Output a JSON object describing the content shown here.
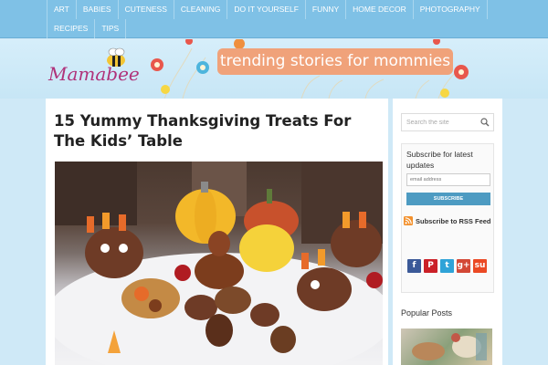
{
  "nav": {
    "row1": [
      "ART",
      "BABIES",
      "CUTENESS",
      "CLEANING",
      "DO IT YOURSELF",
      "FUNNY",
      "HOME DECOR",
      "PHOTOGRAPHY"
    ],
    "row2": [
      "RECIPES",
      "TIPS"
    ]
  },
  "header": {
    "logo": "Mamabee",
    "tagline": "trending stories for mommies"
  },
  "post": {
    "title": "15 Yummy Thanksgiving Treats For The Kids’ Table"
  },
  "sidebar": {
    "search_placeholder": "Search the site",
    "subscribe_text": "Subscribe for latest updates",
    "email_placeholder": "email address",
    "subscribe_button": "SUBSCRIBE",
    "rss_label": "Subscribe to RSS Feed",
    "social": [
      {
        "name": "facebook",
        "glyph": "f",
        "color": "#3b5998"
      },
      {
        "name": "pinterest",
        "glyph": "P",
        "color": "#cb2027"
      },
      {
        "name": "twitter",
        "glyph": "t",
        "color": "#2fa3d8"
      },
      {
        "name": "google-plus",
        "glyph": "g+",
        "color": "#d34836"
      },
      {
        "name": "stumbleupon",
        "glyph": "su",
        "color": "#eb4924"
      }
    ],
    "popular_title": "Popular Posts"
  },
  "colors": {
    "nav_bg": "#7fc1e6",
    "page_bg": "#cfe9f7",
    "logo": "#b0327a",
    "banner": "#f0a27a",
    "button": "#4d9bc2"
  }
}
